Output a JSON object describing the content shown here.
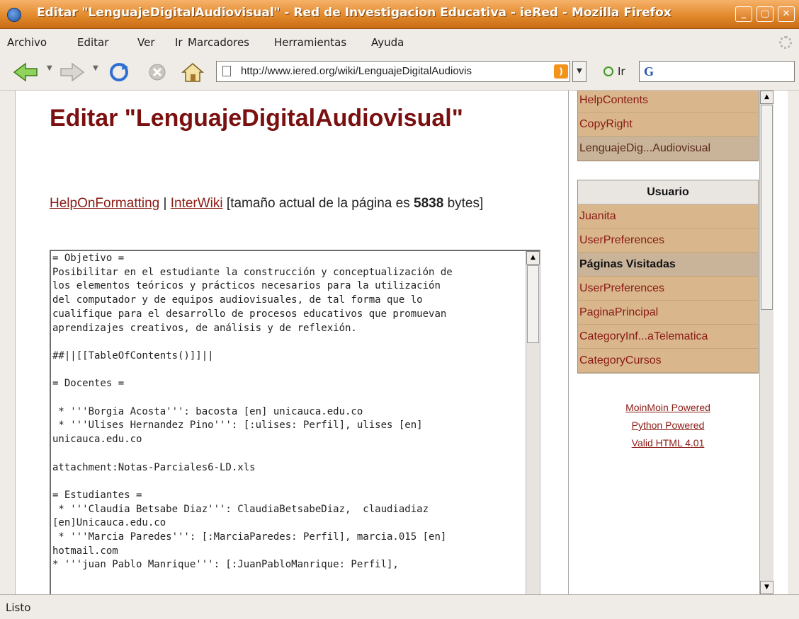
{
  "window": {
    "title": "Editar \"LenguajeDigitalAudiovisual\" - Red de Investigacion Educativa - ieRed - Mozilla Firefox"
  },
  "menu": [
    "Archivo",
    "Editar",
    "Ver",
    "Ir",
    "Marcadores",
    "Herramientas",
    "Ayuda"
  ],
  "toolbar": {
    "url": "http://www.iered.org/wiki/LenguajeDigitalAudiovis",
    "go_label": "Ir",
    "search_engine": "G"
  },
  "page": {
    "title": "Editar \"LenguajeDigitalAudiovisual\"",
    "help_link": "HelpOnFormatting",
    "separator": "|",
    "interwiki_link": "InterWiki",
    "size_prefix": "[tamaño actual de la página es",
    "size_value": "5838",
    "size_suffix": "bytes]",
    "editor_text": "= Objetivo =\nPosibilitar en el estudiante la construcción y conceptualización de\nlos elementos teóricos y prácticos necesarios para la utilización\ndel computador y de equipos audiovisuales, de tal forma que lo\ncualifique para el desarrollo de procesos educativos que promuevan\naprendizajes creativos, de análisis y de reflexión.\n\n##||[[TableOfContents()]]||\n\n= Docentes =\n\n * '''Borgia Acosta''': bacosta [en] unicauca.edu.co\n * '''Ulises Hernandez Pino''': [:ulises: Perfil], ulises [en]\nunicauca.edu.co\n\nattachment:Notas-Parciales6-LD.xls\n\n= Estudiantes =\n * '''Claudia Betsabe Diaz''': ClaudiaBetsabeDiaz,  claudiadiaz\n[en]Unicauca.edu.co\n * '''Marcia Paredes''': [:MarciaParedes: Perfil], marcia.015 [en]\nhotmail.com\n* '''juan Pablo Manrique''': [:JuanPabloManrique: Perfil],"
  },
  "sidebar": {
    "nav_items": [
      "HelpContents",
      "CopyRight",
      "LenguajeDig...Audiovisual"
    ],
    "user_header": "Usuario",
    "user_items": [
      "Juanita",
      "UserPreferences"
    ],
    "visited_header": "Páginas Visitadas",
    "visited_items": [
      "UserPreferences",
      "PaginaPrincipal",
      "CategoryInf...aTelematica",
      "CategoryCursos"
    ],
    "footer_links": [
      "MoinMoin Powered",
      "Python Powered",
      "Valid HTML 4.01"
    ]
  },
  "status": {
    "text": "Listo"
  }
}
